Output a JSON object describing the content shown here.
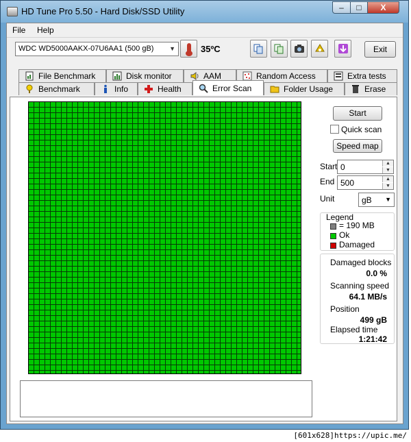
{
  "window": {
    "title": "HD Tune Pro 5.50 - Hard Disk/SSD Utility",
    "min_label": "–",
    "max_label": "□",
    "close_label": "X"
  },
  "menu": {
    "file": "File",
    "help": "Help"
  },
  "toolbar": {
    "drive": "WDC WD5000AAKX-07U6AA1 (500 gB)",
    "temperature": "35ºC",
    "exit_label": "Exit",
    "icons": [
      "copy-info-icon",
      "copy-screen-icon",
      "screenshot-icon",
      "options-icon",
      "save-icon"
    ]
  },
  "tabs_top": [
    {
      "label": "File Benchmark",
      "icon": "file-benchmark-icon"
    },
    {
      "label": "Disk monitor",
      "icon": "disk-monitor-icon"
    },
    {
      "label": "AAM",
      "icon": "speaker-icon"
    },
    {
      "label": "Random Access",
      "icon": "random-access-icon"
    },
    {
      "label": "Extra tests",
      "icon": "extra-tests-icon"
    }
  ],
  "tabs_bottom": [
    {
      "label": "Benchmark",
      "icon": "benchmark-icon"
    },
    {
      "label": "Info",
      "icon": "info-icon"
    },
    {
      "label": "Health",
      "icon": "health-cross-icon"
    },
    {
      "label": "Error Scan",
      "icon": "magnifier-icon",
      "active": true
    },
    {
      "label": "Folder Usage",
      "icon": "folder-icon"
    },
    {
      "label": "Erase",
      "icon": "trash-icon"
    }
  ],
  "scan": {
    "start_button": "Start",
    "quick_scan_label": "Quick scan",
    "quick_scan_checked": false,
    "speed_map_button": "Speed map",
    "start_label": "Start",
    "start_value": "0",
    "end_label": "End",
    "end_value": "500",
    "unit_label": "Unit",
    "unit_value": "gB"
  },
  "legend": {
    "title": "Legend",
    "block_size": "= 190 MB",
    "ok": "Ok",
    "damaged": "Damaged",
    "colors": {
      "block": "#808080",
      "ok": "#00c800",
      "damaged": "#d00000"
    }
  },
  "stats": {
    "damaged_blocks_label": "Damaged blocks",
    "damaged_blocks_value": "0.0 %",
    "scanning_speed_label": "Scanning speed",
    "scanning_speed_value": "64.1 MB/s",
    "position_label": "Position",
    "position_value": "499 gB",
    "elapsed_label": "Elapsed time",
    "elapsed_value": "1:21:42"
  },
  "grid": {
    "status": "all blocks ok",
    "color": "#00c800"
  },
  "footer": {
    "text": "[601x628]https://upic.me/"
  }
}
